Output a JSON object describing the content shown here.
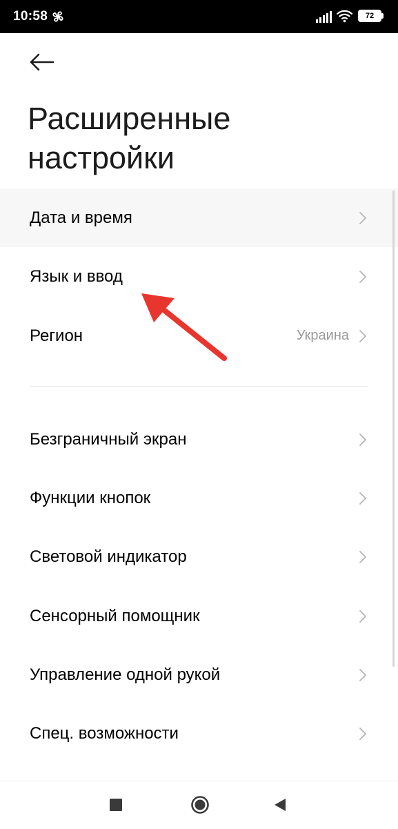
{
  "status_bar": {
    "time": "10:58",
    "battery_level": "72",
    "icons": [
      "fan-icon",
      "signal-icon",
      "wifi-icon",
      "battery-icon"
    ]
  },
  "header": {
    "back_icon": "back-arrow-icon",
    "title": "Расширенные настройки"
  },
  "settings": {
    "items": [
      {
        "label": "Дата и время",
        "value": ""
      },
      {
        "label": "Язык и ввод",
        "value": ""
      },
      {
        "label": "Регион",
        "value": "Украина"
      },
      {
        "label": "Безграничный экран",
        "value": ""
      },
      {
        "label": "Функции кнопок",
        "value": ""
      },
      {
        "label": "Световой индикатор",
        "value": ""
      },
      {
        "label": "Сенсорный помощник",
        "value": ""
      },
      {
        "label": "Управление одной рукой",
        "value": ""
      },
      {
        "label": "Спец. возможности",
        "value": ""
      }
    ]
  },
  "annotation": {
    "type": "arrow-icon",
    "color": "#e8352d"
  },
  "nav_bar": {
    "icons": [
      "recents-icon",
      "home-icon",
      "back-icon"
    ]
  },
  "colors": {
    "accent_arrow": "#e8352d",
    "text_primary": "#000000",
    "text_secondary": "#9a9a9a",
    "pressed_row": "#f7f7f7"
  }
}
